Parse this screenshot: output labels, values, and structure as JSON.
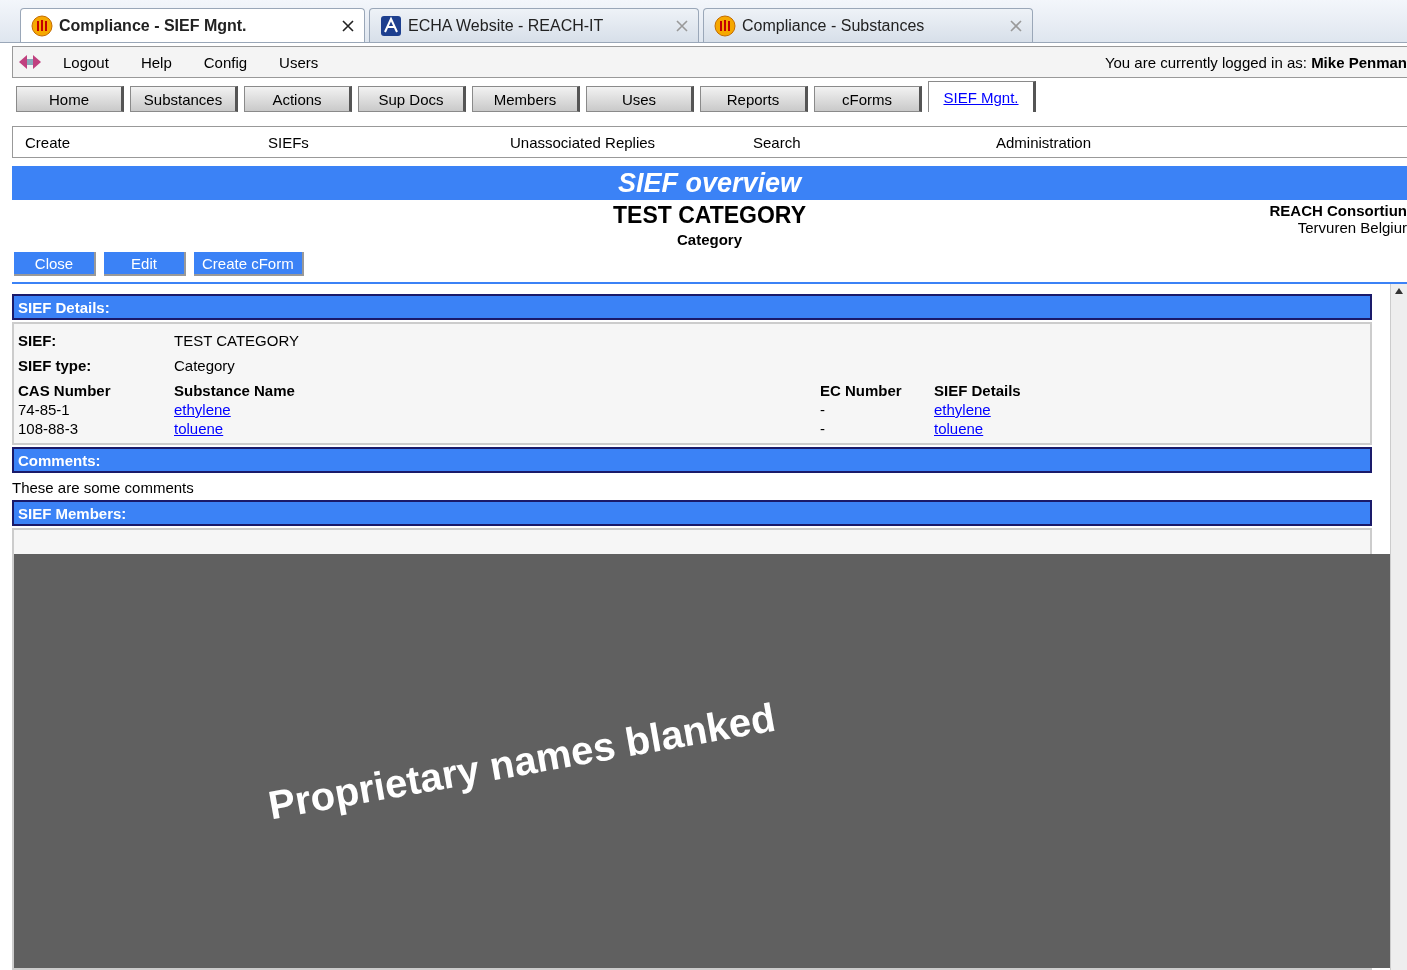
{
  "browser_tabs": [
    {
      "title": "Compliance - SIEF Mgnt.",
      "kind": "compliance",
      "selected": true
    },
    {
      "title": "ECHA Website - REACH-IT",
      "kind": "agency",
      "selected": false
    },
    {
      "title": "Compliance - Substances",
      "kind": "compliance",
      "selected": false
    }
  ],
  "menu": [
    "Logout",
    "Help",
    "Config",
    "Users"
  ],
  "login": {
    "label": "You are currently logged in as:",
    "user": "Mike Penman"
  },
  "nav_tabs": [
    {
      "label": "Home",
      "selected": false
    },
    {
      "label": "Substances",
      "selected": false
    },
    {
      "label": "Actions",
      "selected": false
    },
    {
      "label": "Sup Docs",
      "selected": false
    },
    {
      "label": "Members",
      "selected": false
    },
    {
      "label": "Uses",
      "selected": false
    },
    {
      "label": "Reports",
      "selected": false
    },
    {
      "label": "cForms",
      "selected": false
    },
    {
      "label": "SIEF Mgnt.",
      "selected": true
    }
  ],
  "sub_nav": [
    "Create",
    "SIEFs",
    "Unassociated Replies",
    "Search",
    "Administration"
  ],
  "banner": "SIEF overview",
  "header": {
    "title": "TEST CATEGORY",
    "subtitle": "Category",
    "org": "REACH Consortiun",
    "location": "Tervuren Belgiur"
  },
  "buttons": [
    "Close",
    "Edit",
    "Create cForm"
  ],
  "details": {
    "heading": "SIEF Details:",
    "fields": [
      {
        "label": "SIEF:",
        "value": "TEST CATEGORY"
      },
      {
        "label": "SIEF type:",
        "value": "Category"
      }
    ],
    "columns": [
      "CAS Number",
      "Substance Name",
      "EC Number",
      "SIEF Details"
    ],
    "rows": [
      [
        "74-85-1",
        "ethylene",
        "-",
        "ethylene"
      ],
      [
        "108-88-3",
        "toluene",
        "-",
        "toluene"
      ]
    ]
  },
  "comments": {
    "heading": "Comments:",
    "text": "These are some comments"
  },
  "members": {
    "heading": "SIEF Members:",
    "overlay": "Proprietary names blanked"
  }
}
